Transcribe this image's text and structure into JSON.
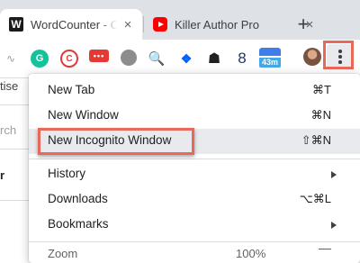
{
  "tabs": [
    {
      "title": "WordCounter - C",
      "favicon": "W",
      "close": "×"
    },
    {
      "title": "Killer Author Pro",
      "favicon": "youtube-icon",
      "close": "×"
    }
  ],
  "new_tab_symbol": "+",
  "extensions": {
    "grammarly": "G",
    "red_circle": "C",
    "red_dots": "•••",
    "search_glyph": "🔍",
    "dropbox_glyph": "❖",
    "ghost_glyph": "☗",
    "infinity_glyph": "8",
    "badge_text": "43m"
  },
  "page_fragments": {
    "left_text_1": "tise",
    "left_text_2": "rch",
    "left_text_3": "r"
  },
  "menu": {
    "items": [
      {
        "label": "New Tab",
        "shortcut": "⌘T"
      },
      {
        "label": "New Window",
        "shortcut": "⌘N"
      },
      {
        "label": "New Incognito Window",
        "shortcut": "⇧⌘N"
      },
      {
        "label": "History",
        "shortcut": ""
      },
      {
        "label": "Downloads",
        "shortcut": "⌥⌘L"
      },
      {
        "label": "Bookmarks",
        "shortcut": ""
      }
    ],
    "zoom_label": "Zoom",
    "zoom_value": "100%"
  },
  "colors": {
    "highlight": "#e8685a",
    "tab_strip": "#dee1e6",
    "hover": "#e8eaed"
  }
}
